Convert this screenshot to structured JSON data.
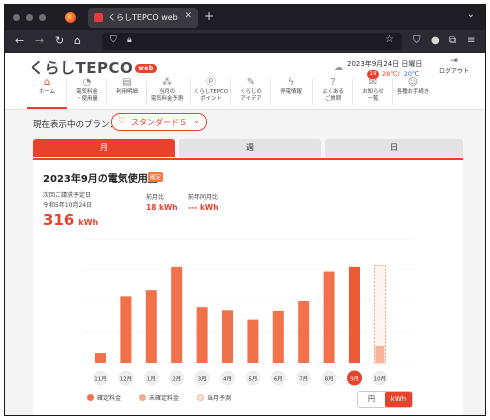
{
  "browser": {
    "tab_title": "くらしTEPCO web",
    "tab_close": "✕",
    "new_tab": "+",
    "tab_menu": "⌄",
    "url": ""
  },
  "header": {
    "logo_text": "くらしTEPCO",
    "logo_badge": "web",
    "date": "2023年9月24日 日曜日",
    "temp_high": "28℃/",
    "temp_low": "20℃",
    "logout_label": "ログアウト",
    "notice_badge": "19"
  },
  "nav": [
    {
      "label1": "ホーム",
      "label2": "",
      "icon": "home-icon",
      "glyph": "⌂"
    },
    {
      "label1": "電気料金",
      "label2": "・使用量",
      "icon": "bulb-icon",
      "glyph": "◔"
    },
    {
      "label1": "利用明細",
      "label2": "",
      "icon": "doc-icon",
      "glyph": "▤"
    },
    {
      "label1": "当月の",
      "label2": "電気料金予測",
      "icon": "forecast-icon",
      "glyph": "⁂"
    },
    {
      "label1": "くらしTEPCO",
      "label2": "ポイント",
      "icon": "point-icon",
      "glyph": "Ⓟ"
    },
    {
      "label1": "くらしの",
      "label2": "アイデア",
      "icon": "idea-icon",
      "glyph": "✎"
    },
    {
      "label1": "停電情報",
      "label2": "",
      "icon": "outage-icon",
      "glyph": "ϟ"
    },
    {
      "label1": "よくある",
      "label2": "ご質問",
      "icon": "faq-icon",
      "glyph": "?"
    },
    {
      "label1": "お知らせ",
      "label2": "一覧",
      "icon": "notice-icon",
      "glyph": "✉"
    },
    {
      "label1": "各種お手続き",
      "label2": "",
      "icon": "user-icon",
      "glyph": "☺"
    }
  ],
  "plan": {
    "label": "現在表示中のプラン：",
    "value": "スタンダードＳ"
  },
  "period_tabs": [
    "月",
    "週",
    "日"
  ],
  "summary": {
    "title": "2023年9月の電気使用量",
    "status_badge": "確定",
    "next_label": "次回ご請求予定日",
    "next_date": "令和5年10月24日",
    "usage_value": "316",
    "usage_unit": "kWh",
    "prev_month_label": "前月比",
    "prev_month_value": "18 kWh",
    "prev_year_label": "前年同月比",
    "prev_year_value": "--- kWh"
  },
  "chart_data": {
    "type": "bar",
    "categories": [
      "11月",
      "12月",
      "1月",
      "2月",
      "3月",
      "4月",
      "5月",
      "6月",
      "7月",
      "8月",
      "9月",
      "10月"
    ],
    "values": [
      32,
      215,
      235,
      310,
      180,
      170,
      140,
      168,
      200,
      295,
      310,
      0
    ],
    "forecast_value": 315,
    "forecast_unconfirmed": 55,
    "selected": "9月",
    "ylim": [
      0,
      400
    ]
  },
  "legend": [
    {
      "label": "確定料金",
      "color": "#f0714a"
    },
    {
      "label": "未確定料金",
      "color": "#f6a98e"
    },
    {
      "label": "当月予測",
      "color": "#fde3d6"
    }
  ],
  "units": {
    "yen": "円",
    "kwh": "kWh"
  },
  "colors": {
    "accent": "#e8412c",
    "bar": "#f0714a"
  }
}
